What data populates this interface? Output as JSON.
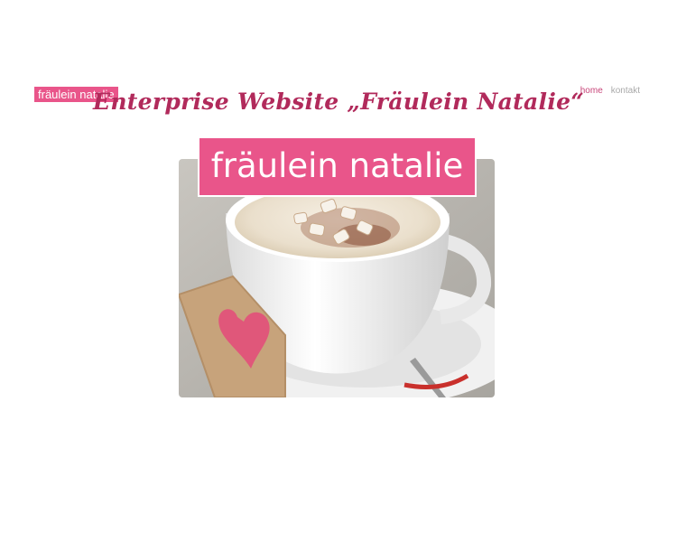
{
  "brand": {
    "logo_text": "fräulein natalie"
  },
  "nav": {
    "items": [
      {
        "label": "home"
      },
      {
        "label": "kontakt"
      }
    ]
  },
  "headline": "Enterprise Website „Fräulein Natalie“",
  "hero": {
    "badge_text": "fräulein natalie",
    "photo_subject": "coffee-cup-photo"
  },
  "colors": {
    "brand_pink": "#e9558a",
    "headline_crimson": "#b12a5b",
    "nav_active": "#c8467a",
    "nav_inactive": "#a9a9a9",
    "background": "#ffffff"
  }
}
